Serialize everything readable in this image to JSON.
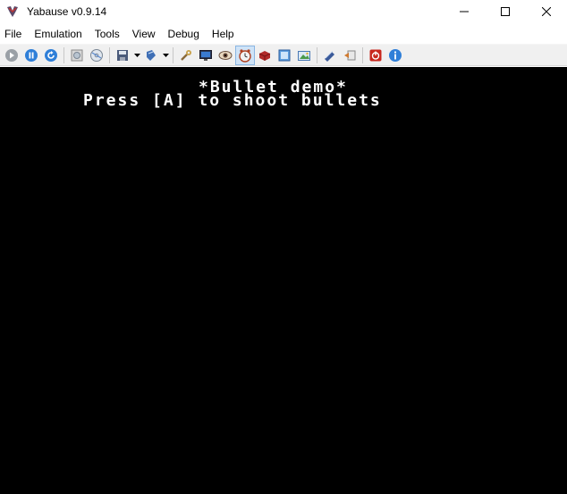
{
  "window": {
    "title": "Yabause v0.9.14",
    "icon": "yabause-logo-icon"
  },
  "menu": {
    "items": [
      "File",
      "Emulation",
      "Tools",
      "View",
      "Debug",
      "Help"
    ]
  },
  "toolbar": {
    "buttons": [
      "run-icon",
      "pause-icon",
      "reset-icon",
      "open-cd-icon",
      "open-iso-icon",
      "save-state-icon",
      "load-state-icon",
      "settings-icon",
      "monitor-icon",
      "eye-icon",
      "clock-icon",
      "cartridge-icon",
      "fullscreen-icon",
      "screenshot-icon",
      "cheats-icon",
      "transfer-icon",
      "quit-icon",
      "about-icon"
    ]
  },
  "screen": {
    "line1": "*Bullet demo*",
    "line2": "Press [A] to shoot bullets"
  },
  "colors": {
    "screen_bg": "#000000",
    "screen_text": "#ffffff",
    "toolbar_bg": "#f0f0f0",
    "toolbar_pressed": "#cfe3f7"
  }
}
